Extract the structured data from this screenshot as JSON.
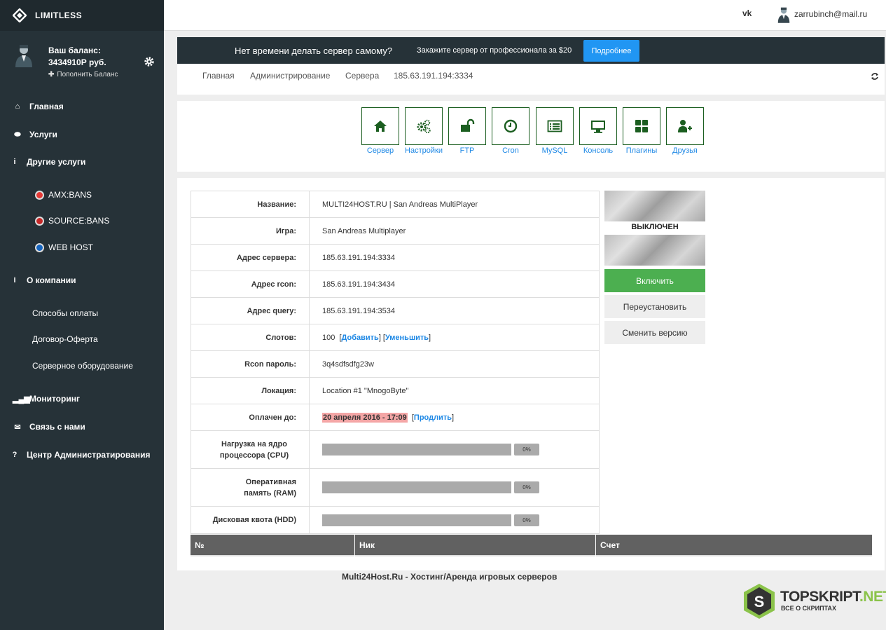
{
  "sidebar": {
    "brand": "LIMITLESS",
    "balance_label": "Ваш баланс:",
    "balance_value": "3434910Р руб.",
    "topup": "Пополнить Баланс",
    "items": [
      {
        "label": "Главная",
        "icon": "home-icon"
      },
      {
        "label": "Услуги",
        "icon": "gamepad-icon"
      },
      {
        "label": "Другие услуги",
        "icon": "info-icon"
      },
      {
        "label": "О компании",
        "icon": "info-icon"
      },
      {
        "label": "Мониторинг",
        "icon": "signal-icon"
      },
      {
        "label": "Связь с нами",
        "icon": "mail-icon"
      },
      {
        "label": "Центр Администратирования",
        "icon": "question-icon"
      }
    ],
    "other_services": [
      "AMX:BANS",
      "SOURCE:BANS",
      "WEB HOST"
    ],
    "company_links": [
      "Способы оплаты",
      "Договор-Оферта",
      "Серверное оборудование"
    ]
  },
  "topbar": {
    "vk": "vk",
    "email": "zarrubinch@mail.ru"
  },
  "promo": {
    "text": "Нет времени делать сервер самому?",
    "offer": "Закажите сервер от профессионала за $20",
    "button": "Подробнее"
  },
  "breadcrumb": [
    "Главная",
    "Администрирование",
    "Сервера",
    "185.63.191.194:3334"
  ],
  "tiles": [
    {
      "label": "Сервер",
      "icon": "home-icon"
    },
    {
      "label": "Настройки",
      "icon": "cogs-icon"
    },
    {
      "label": "FTP",
      "icon": "unlock-icon"
    },
    {
      "label": "Cron",
      "icon": "clock-icon"
    },
    {
      "label": "MySQL",
      "icon": "list-icon"
    },
    {
      "label": "Консоль",
      "icon": "monitor-icon"
    },
    {
      "label": "Плагины",
      "icon": "grid-icon"
    },
    {
      "label": "Друзья",
      "icon": "add-user-icon"
    }
  ],
  "server": {
    "name_label": "Название:",
    "name": "MULTI24HOST.RU | San Andreas MultiPlayer",
    "game_label": "Игра:",
    "game": "San Andreas Multiplayer",
    "addr_label": "Адрес сервера:",
    "addr": "185.63.191.194:3334",
    "rcon_addr_label": "Адрес rcon:",
    "rcon_addr": "185.63.191.194:3434",
    "query_label": "Адрес query:",
    "query": "185.63.191.194:3534",
    "slots_label": "Слотов:",
    "slots": "100",
    "slots_add": "Добавить",
    "slots_reduce": "Уменьшить",
    "rcon_pass_label": "Rcon пароль:",
    "rcon_pass": "3q4sdfsdfg23w",
    "location_label": "Локация:",
    "location": "Location #1 \"MnogoByte\"",
    "paid_label": "Оплачен до:",
    "paid": "20 апреля 2016 - 17:09",
    "extend": "Продлить",
    "cpu_label": "Нагрузка на ядро процессора (CPU)",
    "cpu": "0%",
    "ram_label": "Оперативная память (RAM)",
    "ram": "0%",
    "hdd_label": "Дисковая квота (HDD)",
    "hdd": "0%",
    "cpu_level": 0,
    "ram_level": 0,
    "hdd_level": 0
  },
  "status": {
    "state": "ВЫКЛЮЧЕН",
    "on_button": "Включить",
    "reinstall_button": "Переустановить",
    "version_button": "Сменить версию"
  },
  "players": {
    "headers": [
      "№",
      "Ник",
      "Счет"
    ]
  },
  "footer": "Multi24Host.Ru - Хостинг/Аренда игровых серверов",
  "watermark": {
    "brand_a": "TOPSKRIPT",
    "brand_b": ".NET",
    "sub": "ВСЕ О СКРИПТАХ",
    "letter": "S"
  },
  "colors": {
    "sidebar": "#263238",
    "accent": "#2196f3",
    "success": "#4caf50",
    "tile_border": "#1b5e20",
    "link": "#1e88e5"
  }
}
